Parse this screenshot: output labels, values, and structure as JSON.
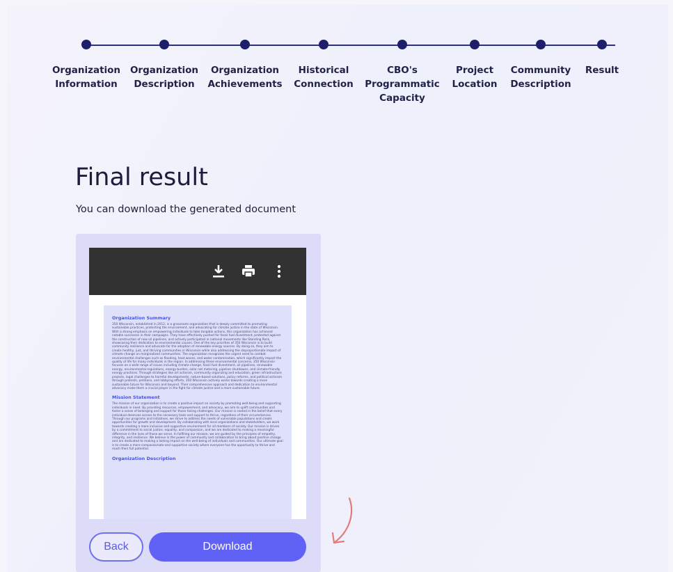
{
  "stepper": {
    "steps": [
      {
        "label": "Organization\nInformation"
      },
      {
        "label": "Organization\nDescription"
      },
      {
        "label": "Organization\nAchievements"
      },
      {
        "label": "Historical\nConnection"
      },
      {
        "label": "CBO's\nProgrammatic\nCapacity"
      },
      {
        "label": "Project\nLocation"
      },
      {
        "label": "Community\nDescription"
      },
      {
        "label": "Result"
      }
    ]
  },
  "main": {
    "title": "Final result",
    "subtitle": "You can download the generated document"
  },
  "viewer": {
    "toolbar_icons": [
      "download-icon",
      "print-icon",
      "more-vertical-icon"
    ],
    "document": {
      "sections": [
        {
          "heading": "Organization Summary",
          "body": "350 Wisconsin, established in 2012, is a grassroots organization that is deeply committed to promoting sustainable practices, protecting the environment, and advocating for climate justice in the state of Wisconsin. With a strong emphasis on empowering individuals to take tangible actions, this organization has achieved notable successes in their campaigns. They have effectively pushed for fossil fuel divestment, protested against the construction of new oil pipelines, and actively participated in national movements like Standing Rock, showcasing their dedication to environmental causes. One of the key priorities of 350 Wisconsin is to build community resilience and advocate for the adoption of renewable energy sources. By doing so, they aim to create healthy, just, and thriving communities in Wisconsin while also addressing the disproportionate impact of climate change on marginalized communities. The organization recognizes the urgent need to combat environmental challenges such as flooding, heat waves, and water contamination, which significantly impact the quality of life for many individuals in the region. In addressing these environmental concerns, 350 Wisconsin focuses on a wide range of issues including climate change, fossil fuel divestment, oil pipelines, renewable energy, environmental regulations, energy burden, solar net metering, pipeline shutdowns, and climate-friendly energy practices. Through strategies like art activism, community organizing and education, green infrastructure projects, legal challenges to harmful developments, nature-based solutions, policy reforms, and political activism through protests, petitions, and lobbying efforts, 350 Wisconsin actively works towards creating a more sustainable future for Wisconsin and beyond. Their comprehensive approach and dedication to environmental advocacy make them a crucial player in the fight for climate justice and a more sustainable future."
        },
        {
          "heading": "Mission Statement",
          "body": "The mission of our organization is to create a positive impact on society by promoting well-being and supporting individuals in need. By providing resources, empowerment, and advocacy, we aim to uplift communities and foster a sense of belonging and support for those facing challenges. Our mission is rooted in the belief that every individual deserves access to the necessary tools and support to thrive, regardless of their circumstances. Through our programs and initiatives, we strive to address the needs of vulnerable populations and create opportunities for growth and development. By collaborating with local organizations and stakeholders, we work towards creating a more inclusive and supportive environment for all members of society. Our mission is driven by a commitment to social justice, equality, and compassion, and we are dedicated to making a meaningful difference in the lives of those we serve. In fulfilling our mission, we are guided by the principles of empathy, integrity, and resilience. We believe in the power of community and collaboration to bring about positive change and are dedicated to making a lasting impact on the well-being of individuals and communities. Our ultimate goal is to create a more compassionate and supportive society where everyone has the opportunity to thrive and reach their full potential."
        },
        {
          "heading": "Organization Description",
          "body": ""
        }
      ]
    }
  },
  "actions": {
    "back_label": "Back",
    "download_label": "Download"
  },
  "colors": {
    "accent": "#5f62f4",
    "stepper": "#1d1f6b",
    "arrow": "#e57a7a"
  }
}
